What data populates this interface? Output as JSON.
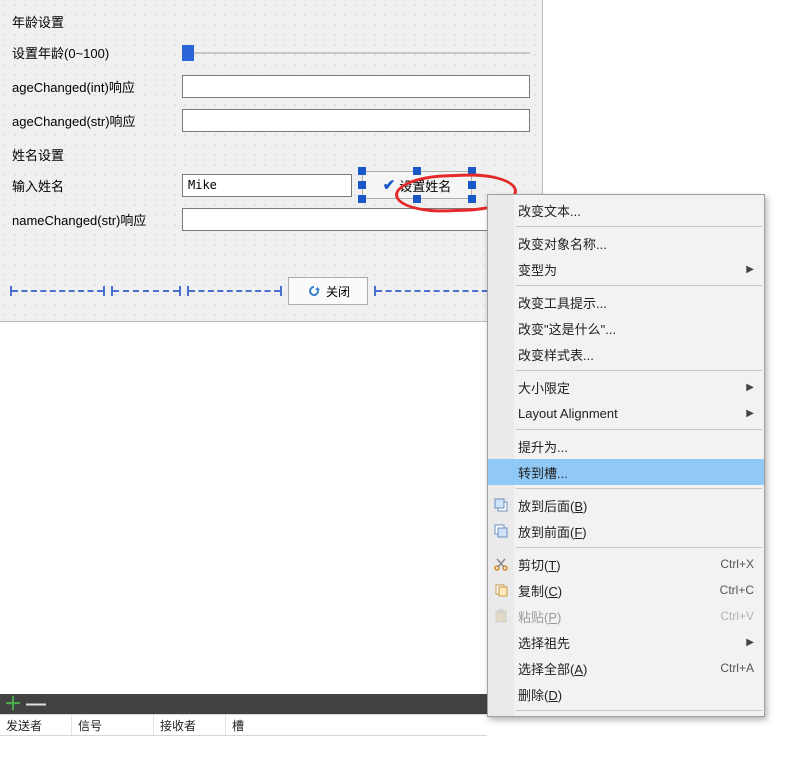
{
  "form": {
    "age_heading": "年龄设置",
    "age_slider_label": "设置年龄(0~100)",
    "age_changed_int_label": "ageChanged(int)响应",
    "age_changed_int_value": "",
    "age_changed_str_label": "ageChanged(str)响应",
    "age_changed_str_value": "",
    "name_heading": "姓名设置",
    "name_input_label": "输入姓名",
    "name_input_value": "Mike",
    "set_name_button": "设置姓名",
    "name_changed_str_label": "nameChanged(str)响应",
    "name_changed_str_value": "",
    "close_button": "关闭"
  },
  "menu": {
    "change_text": "改变文本...",
    "change_object_name": "改变对象名称...",
    "morph_into": "变型为",
    "change_tooltip": "改变工具提示...",
    "change_whatsthis": "改变\"这是什么\"...",
    "change_stylesheet": "改变样式表...",
    "size_constraints": "大小限定",
    "layout_alignment": "Layout Alignment",
    "promote_to": "提升为...",
    "go_to_slot": "转到槽...",
    "send_to_back": "放到后面(B)",
    "bring_to_front": "放到前面(F)",
    "cut": "剪切(T)",
    "copy": "复制(C)",
    "paste": "粘贴(P)",
    "select_ancestor": "选择祖先",
    "select_all": "选择全部(A)",
    "delete": "删除(D)",
    "shortcuts": {
      "cut": "Ctrl+X",
      "copy": "Ctrl+C",
      "paste": "Ctrl+V",
      "select_all": "Ctrl+A"
    }
  },
  "bottom": {
    "col_sender": "发送者",
    "col_signal": "信号",
    "col_receiver": "接收者",
    "col_slot": "槽"
  }
}
